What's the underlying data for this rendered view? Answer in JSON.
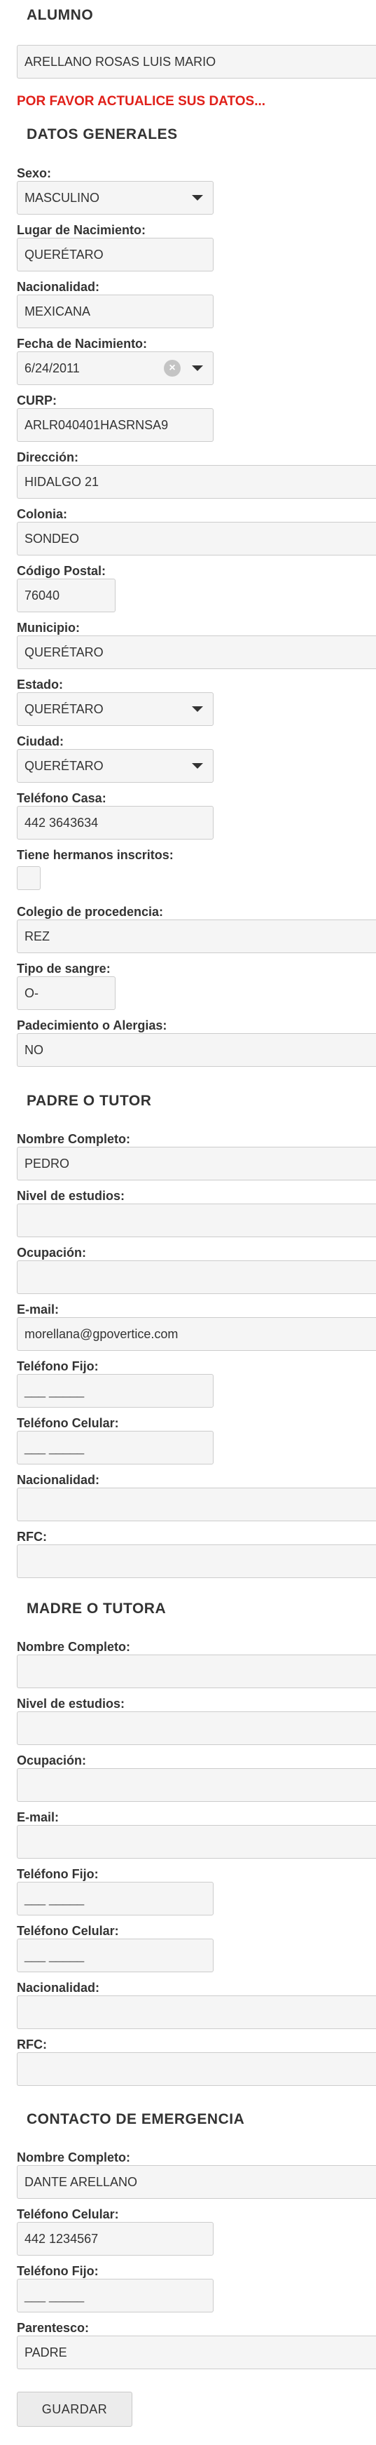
{
  "alumno": {
    "heading": "ALUMNO",
    "name_value": "ARELLANO ROSAS LUIS MARIO",
    "alert": "POR FAVOR ACTUALICE SUS DATOS..."
  },
  "datos_generales": {
    "heading": "DATOS GENERALES",
    "fields": [
      {
        "label": "Sexo:",
        "value": "MASCULINO",
        "type": "select"
      },
      {
        "label": "Lugar de Nacimiento:",
        "value": "QUERÉTARO",
        "type": "text"
      },
      {
        "label": "Nacionalidad:",
        "value": "MEXICANA",
        "type": "text"
      },
      {
        "label": "Fecha de Nacimiento:",
        "value": "6/24/2011",
        "type": "date"
      },
      {
        "label": "CURP:",
        "value": "ARLR040401HASRNSA9",
        "type": "text"
      },
      {
        "label": "Dirección:",
        "value": "HIDALGO 21",
        "type": "text"
      },
      {
        "label": "Colonia:",
        "value": "SONDEO",
        "type": "text"
      },
      {
        "label": "Código Postal:",
        "value": "76040",
        "type": "text"
      },
      {
        "label": "Municipio:",
        "value": "QUERÉTARO",
        "type": "text"
      },
      {
        "label": "Estado:",
        "value": "QUERÉTARO",
        "type": "select"
      },
      {
        "label": "Ciudad:",
        "value": "QUERÉTARO",
        "type": "select"
      },
      {
        "label": "Teléfono Casa:",
        "value": "442 3643634",
        "type": "text"
      },
      {
        "label": "Tiene hermanos inscritos:",
        "value": "",
        "type": "checkbox"
      },
      {
        "label": "Colegio de procedencia:",
        "value": "REZ",
        "type": "text"
      },
      {
        "label": "Tipo de sangre:",
        "value": "O-",
        "type": "text"
      },
      {
        "label": "Padecimiento o Alergias:",
        "value": "NO",
        "type": "text"
      }
    ]
  },
  "padre": {
    "heading": "PADRE O TUTOR",
    "fields": [
      {
        "label": "Nombre Completo:",
        "value": "PEDRO"
      },
      {
        "label": "Nivel de estudios:",
        "value": ""
      },
      {
        "label": "Ocupación:",
        "value": ""
      },
      {
        "label": "E-mail:",
        "value": "morellana@gpovertice.com"
      },
      {
        "label": "Teléfono Fijo:",
        "value": "___ _____"
      },
      {
        "label": "Teléfono Celular:",
        "value": "___ _____"
      },
      {
        "label": "Nacionalidad:",
        "value": ""
      },
      {
        "label": "RFC:",
        "value": ""
      }
    ]
  },
  "madre": {
    "heading": "MADRE O TUTORA",
    "fields": [
      {
        "label": "Nombre Completo:",
        "value": ""
      },
      {
        "label": "Nivel de estudios:",
        "value": ""
      },
      {
        "label": "Ocupación:",
        "value": ""
      },
      {
        "label": "E-mail:",
        "value": ""
      },
      {
        "label": "Teléfono Fijo:",
        "value": "___ _____"
      },
      {
        "label": "Teléfono Celular:",
        "value": "___ _____"
      },
      {
        "label": "Nacionalidad:",
        "value": ""
      },
      {
        "label": "RFC:",
        "value": ""
      }
    ]
  },
  "emergencia": {
    "heading": "CONTACTO DE EMERGENCIA",
    "fields": [
      {
        "label": "Nombre Completo:",
        "value": "DANTE ARELLANO"
      },
      {
        "label": "Teléfono Celular:",
        "value": "442 1234567"
      },
      {
        "label": "Teléfono Fijo:",
        "value": "___ _____"
      },
      {
        "label": "Parentesco:",
        "value": "PADRE"
      }
    ]
  },
  "actions": {
    "save_label": "GUARDAR"
  },
  "icons": {
    "select": "chevron-down-icon",
    "clear": "clear-icon"
  }
}
